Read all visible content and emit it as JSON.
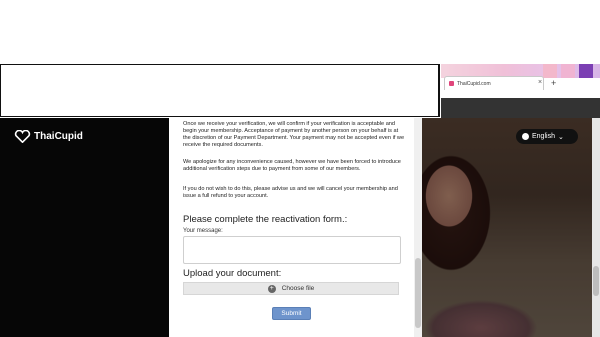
{
  "browser": {
    "tab_title": "ThaiCupid.com",
    "tab_close": "×",
    "new_tab": "+"
  },
  "site": {
    "logo_thai": "Thai",
    "logo_cupid": "Cupid",
    "language": "English"
  },
  "content": {
    "para1": "Once we receive your verification, we will confirm if your verification is acceptable and begin your membership. Acceptance of payment by another person on your behalf is at the discretion of our Payment Department. Your payment may not be accepted even if we receive the required documents.",
    "para2": "We apologize for any inconvenience caused, however we have been forced to introduce additional verification steps due to payment from some of our members.",
    "para3": "If you do not wish to do this, please advise us and we will cancel your membership and issue a full refund to your account.",
    "form_heading": "Please complete the reactivation form.:",
    "message_label": "Your message:",
    "upload_heading": "Upload your document:",
    "choose_file": "Choose file",
    "submit": "Submit"
  },
  "colors": {
    "submit_bg": "#6e94cc",
    "site_bg": "#060606"
  }
}
